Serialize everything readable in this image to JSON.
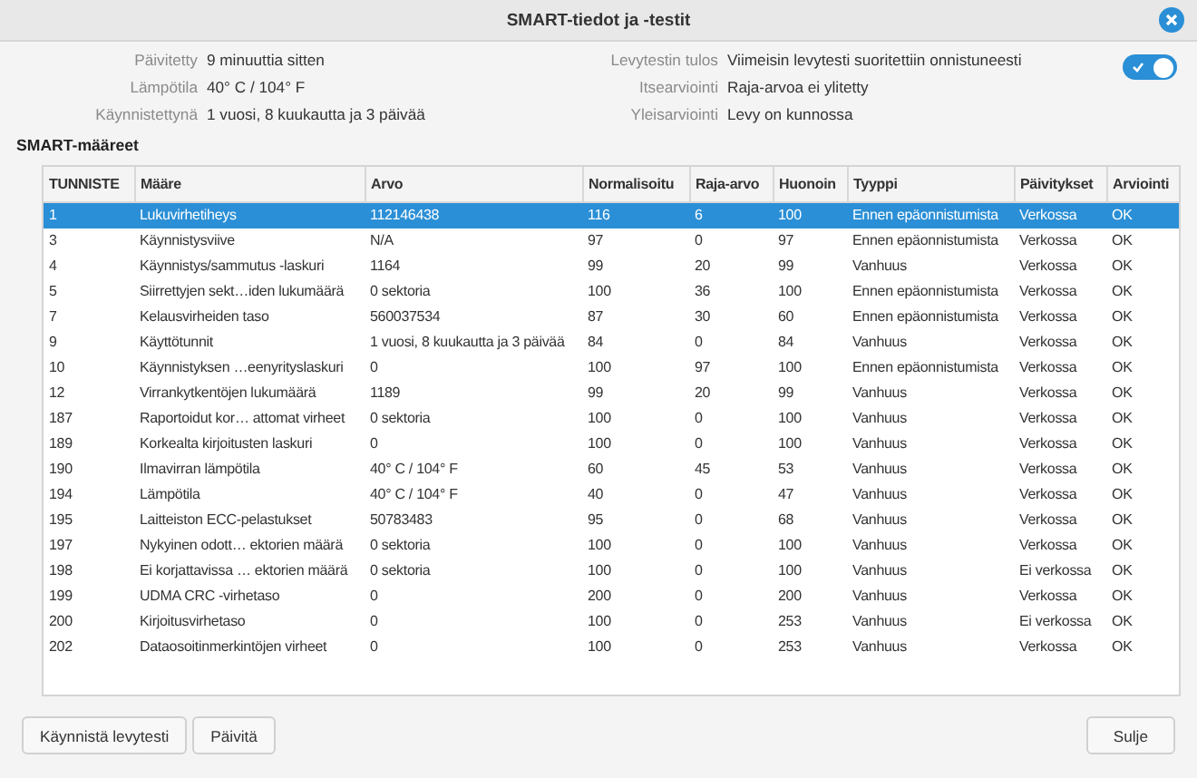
{
  "window": {
    "title": "SMART-tiedot ja -testit"
  },
  "info_left": [
    {
      "label": "Päivitetty",
      "value": "9 minuuttia sitten"
    },
    {
      "label": "Lämpötila",
      "value": "40° C / 104° F"
    },
    {
      "label": "Käynnistettynä",
      "value": "1 vuosi, 8 kuukautta ja 3 päivää"
    }
  ],
  "info_right": [
    {
      "label": "Levytestin tulos",
      "value": "Viimeisin levytesti suoritettiin onnistuneesti"
    },
    {
      "label": "Itsearviointi",
      "value": "Raja-arvoa ei ylitetty"
    },
    {
      "label": "Yleisarviointi",
      "value": "Levy on kunnossa"
    }
  ],
  "smart_switch": {
    "on": true
  },
  "section_title": "SMART-määreet",
  "table": {
    "columns": [
      "TUNNISTE",
      "Määre",
      "Arvo",
      "Normalisoitu",
      "Raja-arvo",
      "Huonoin",
      "Tyyppi",
      "Päivitykset",
      "Arviointi"
    ],
    "rows": [
      {
        "selected": true,
        "cells": [
          "1",
          "Lukuvirhetiheys",
          "112146438",
          "116",
          "6",
          "100",
          "Ennen epäonnistumista",
          "Verkossa",
          "OK"
        ]
      },
      {
        "selected": false,
        "cells": [
          "3",
          "Käynnistysviive",
          "N/A",
          "97",
          "0",
          "97",
          "Ennen epäonnistumista",
          "Verkossa",
          "OK"
        ]
      },
      {
        "selected": false,
        "cells": [
          "4",
          "Käynnistys/sammutus -laskuri",
          "1164",
          "99",
          "20",
          "99",
          "Vanhuus",
          "Verkossa",
          "OK"
        ]
      },
      {
        "selected": false,
        "cells": [
          "5",
          "Siirrettyjen sekt…iden lukumäärä",
          "0 sektoria",
          "100",
          "36",
          "100",
          "Ennen epäonnistumista",
          "Verkossa",
          "OK"
        ]
      },
      {
        "selected": false,
        "cells": [
          "7",
          "Kelausvirheiden taso",
          "560037534",
          "87",
          "30",
          "60",
          "Ennen epäonnistumista",
          "Verkossa",
          "OK"
        ]
      },
      {
        "selected": false,
        "cells": [
          "9",
          "Käyttötunnit",
          "1 vuosi, 8 kuukautta ja 3 päivää",
          "84",
          "0",
          "84",
          "Vanhuus",
          "Verkossa",
          "OK"
        ]
      },
      {
        "selected": false,
        "cells": [
          "10",
          "Käynnistyksen …eenyrityslaskuri",
          "0",
          "100",
          "97",
          "100",
          "Ennen epäonnistumista",
          "Verkossa",
          "OK"
        ]
      },
      {
        "selected": false,
        "cells": [
          "12",
          "Virrankytkentöjen lukumäärä",
          "1189",
          "99",
          "20",
          "99",
          "Vanhuus",
          "Verkossa",
          "OK"
        ]
      },
      {
        "selected": false,
        "cells": [
          "187",
          "Raportoidut kor… attomat virheet",
          "0 sektoria",
          "100",
          "0",
          "100",
          "Vanhuus",
          "Verkossa",
          "OK"
        ]
      },
      {
        "selected": false,
        "cells": [
          "189",
          "Korkealta kirjoitusten laskuri",
          "0",
          "100",
          "0",
          "100",
          "Vanhuus",
          "Verkossa",
          "OK"
        ]
      },
      {
        "selected": false,
        "cells": [
          "190",
          "Ilmavirran lämpötila",
          "40° C / 104° F",
          "60",
          "45",
          "53",
          "Vanhuus",
          "Verkossa",
          "OK"
        ]
      },
      {
        "selected": false,
        "cells": [
          "194",
          "Lämpötila",
          "40° C / 104° F",
          "40",
          "0",
          "47",
          "Vanhuus",
          "Verkossa",
          "OK"
        ]
      },
      {
        "selected": false,
        "cells": [
          "195",
          "Laitteiston ECC-pelastukset",
          "50783483",
          "95",
          "0",
          "68",
          "Vanhuus",
          "Verkossa",
          "OK"
        ]
      },
      {
        "selected": false,
        "cells": [
          "197",
          "Nykyinen odott… ektorien määrä",
          "0 sektoria",
          "100",
          "0",
          "100",
          "Vanhuus",
          "Verkossa",
          "OK"
        ]
      },
      {
        "selected": false,
        "cells": [
          "198",
          "Ei korjattavissa … ektorien määrä",
          "0 sektoria",
          "100",
          "0",
          "100",
          "Vanhuus",
          "Ei verkossa",
          "OK"
        ]
      },
      {
        "selected": false,
        "cells": [
          "199",
          "UDMA CRC -virhetaso",
          "0",
          "200",
          "0",
          "200",
          "Vanhuus",
          "Verkossa",
          "OK"
        ]
      },
      {
        "selected": false,
        "cells": [
          "200",
          "Kirjoitusvirhetaso",
          "0",
          "100",
          "0",
          "253",
          "Vanhuus",
          "Ei verkossa",
          "OK"
        ]
      },
      {
        "selected": false,
        "cells": [
          "202",
          "Dataosoitinmerkintöjen virheet",
          "0",
          "100",
          "0",
          "253",
          "Vanhuus",
          "Verkossa",
          "OK"
        ]
      }
    ]
  },
  "buttons_left": [
    "Käynnistä levytesti",
    "Päivitä"
  ],
  "buttons_right": [
    "Sulje"
  ]
}
